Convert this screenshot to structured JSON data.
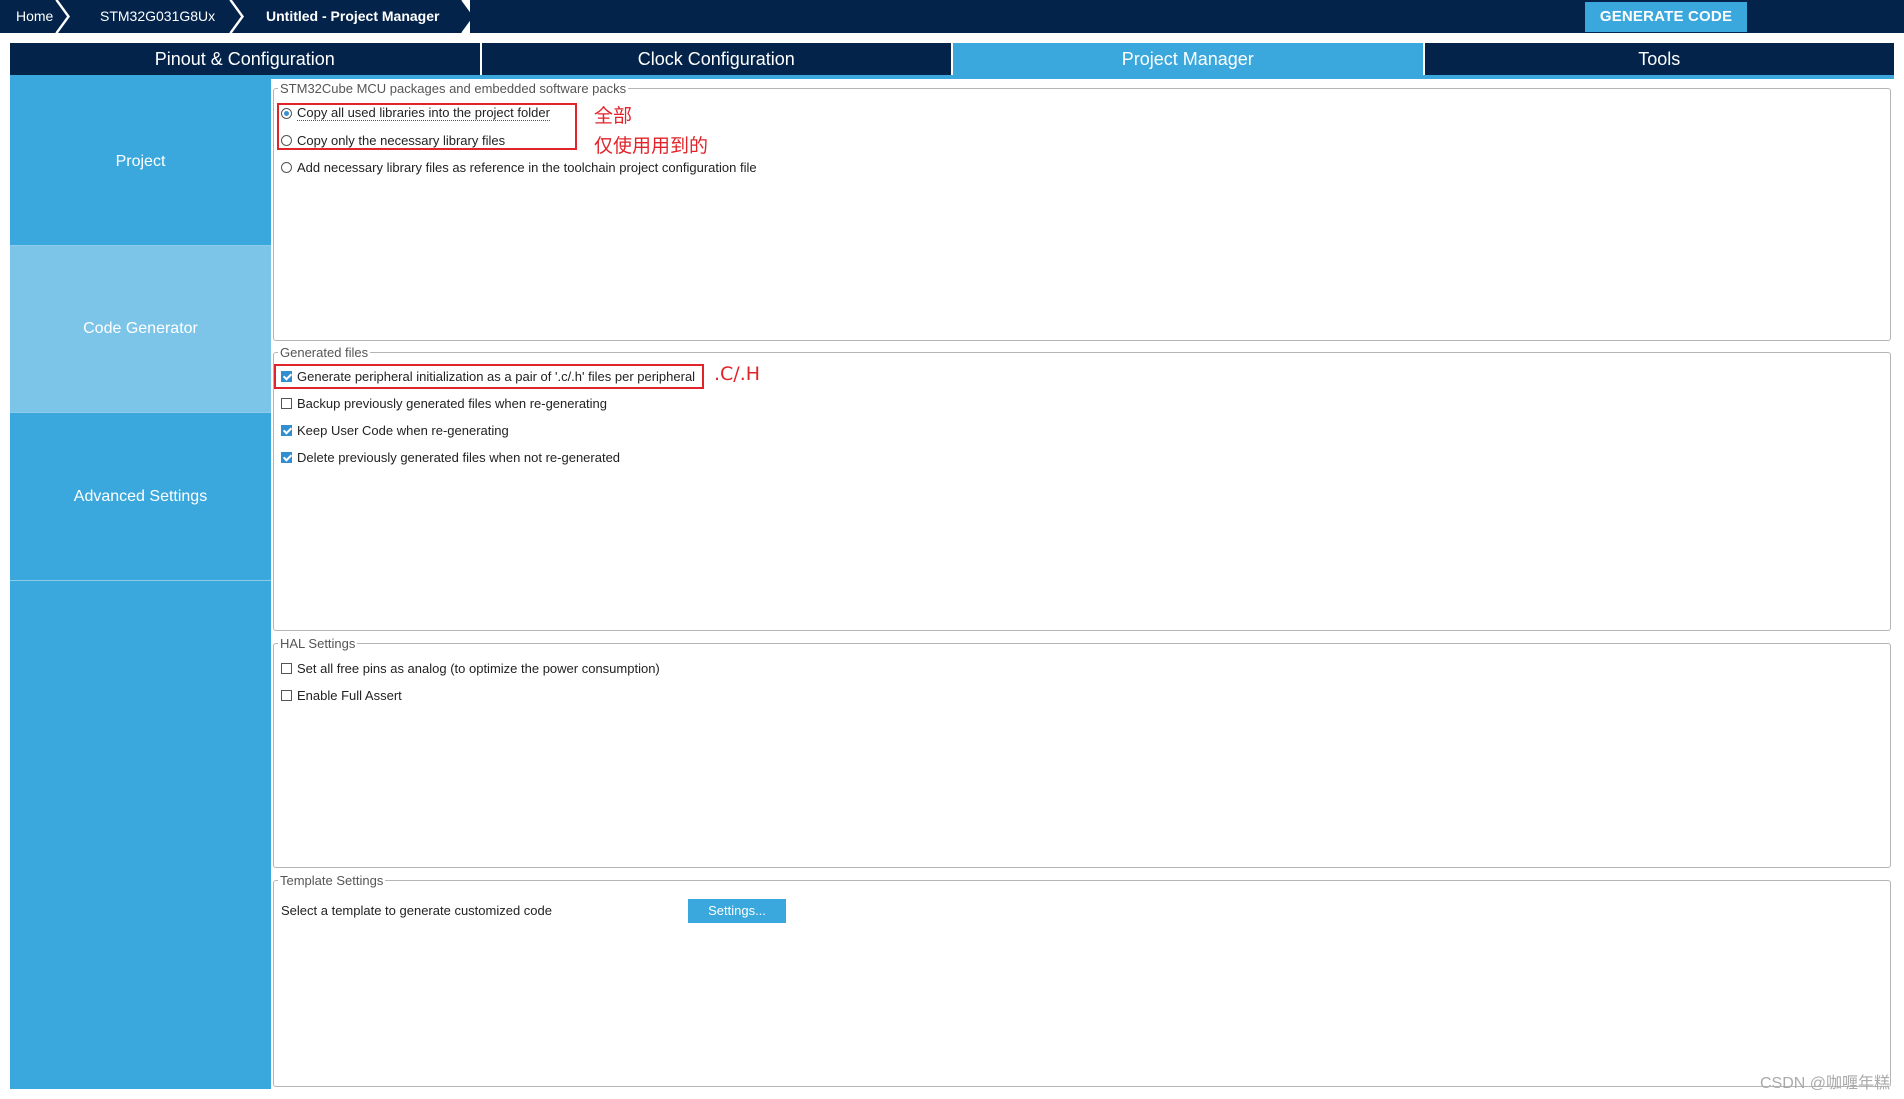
{
  "breadcrumb": {
    "home": "Home",
    "device": "STM32G031G8Ux",
    "current": "Untitled - Project Manager"
  },
  "toolbar": {
    "generate_code": "GENERATE CODE"
  },
  "tabs": [
    {
      "label": "Pinout & Configuration",
      "active": false
    },
    {
      "label": "Clock Configuration",
      "active": false
    },
    {
      "label": "Project Manager",
      "active": true
    },
    {
      "label": "Tools",
      "active": false
    }
  ],
  "sidebar": {
    "items": [
      {
        "label": "Project",
        "active": false
      },
      {
        "label": "Code Generator",
        "active": true
      },
      {
        "label": "Advanced Settings",
        "active": false
      }
    ]
  },
  "packages_group": {
    "legend": "STM32Cube MCU packages and embedded software packs",
    "options": [
      {
        "label": "Copy all used libraries into the project folder",
        "selected": true
      },
      {
        "label": "Copy only the necessary library files",
        "selected": false
      },
      {
        "label": "Add necessary library files as reference in the toolchain project configuration file",
        "selected": false
      }
    ]
  },
  "generated_group": {
    "legend": "Generated files",
    "options": [
      {
        "label": "Generate peripheral initialization as a pair of '.c/.h' files per peripheral",
        "checked": true
      },
      {
        "label": "Backup previously generated files when re-generating",
        "checked": false
      },
      {
        "label": "Keep User Code when re-generating",
        "checked": true
      },
      {
        "label": "Delete previously generated files when not re-generated",
        "checked": true
      }
    ]
  },
  "hal_group": {
    "legend": "HAL Settings",
    "options": [
      {
        "label": "Set all free pins as analog (to optimize the power consumption)",
        "checked": false
      },
      {
        "label": "Enable Full Assert",
        "checked": false
      }
    ]
  },
  "template_group": {
    "legend": "Template Settings",
    "label": "Select a template to generate customized code",
    "button": "Settings..."
  },
  "annotations": {
    "all": "全部",
    "only_used": "仅使用用到的",
    "ch": ".C/.H"
  },
  "watermark": "CSDN @咖喱年糕",
  "colors": {
    "navy": "#03234b",
    "accent": "#3aa8dc",
    "sidebar_active": "#7dc5e8",
    "annotation_red": "#e0242a"
  }
}
